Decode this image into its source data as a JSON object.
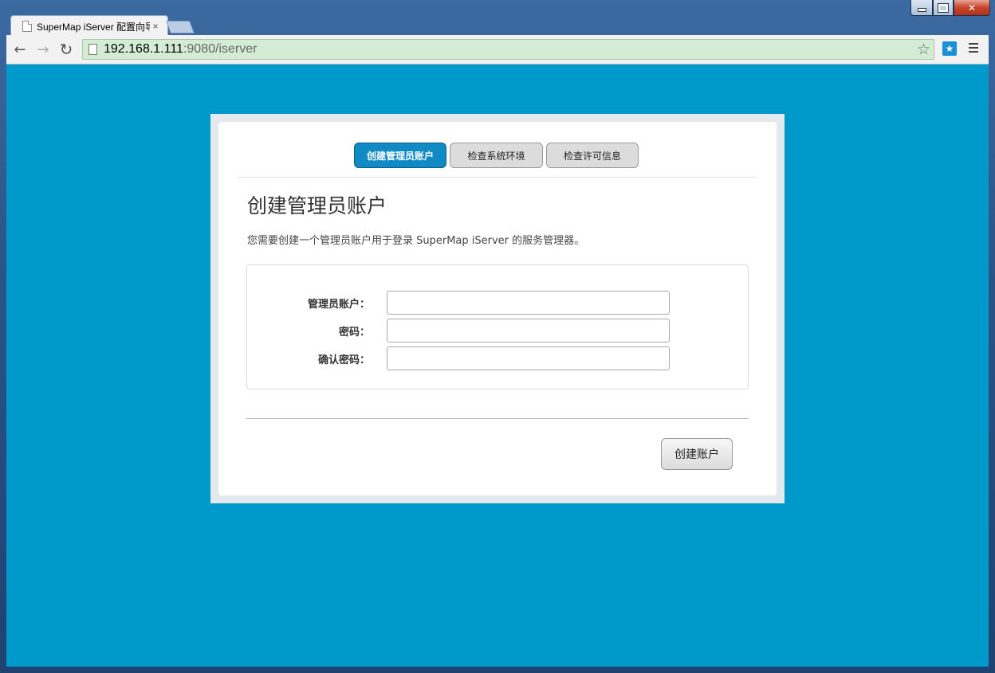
{
  "browser": {
    "tab_title": "SuperMap iServer 配置向导",
    "tab_close": "×",
    "url_host": "192.168.1.111",
    "url_rest": ":9080/iserver",
    "back_icon": "←",
    "forward_icon": "→",
    "reload_icon": "↻",
    "star_icon": "☆",
    "ext_icon": "★"
  },
  "wizard": {
    "steps": [
      {
        "label": "创建管理员账户",
        "active": true
      },
      {
        "label": "检查系统环境",
        "active": false
      },
      {
        "label": "检查许可信息",
        "active": false
      }
    ],
    "title": "创建管理员账户",
    "description": "您需要创建一个管理员账户用于登录 SuperMap iServer 的服务管理器。",
    "fields": [
      {
        "label": "管理员账户：",
        "value": ""
      },
      {
        "label": "密码：",
        "value": ""
      },
      {
        "label": "确认密码：",
        "value": ""
      }
    ],
    "submit_label": "创建账户"
  },
  "colors": {
    "page_background": "#0099cc",
    "active_step": "#0f8ac4",
    "omnibox_secure": "#d4ecd4"
  }
}
